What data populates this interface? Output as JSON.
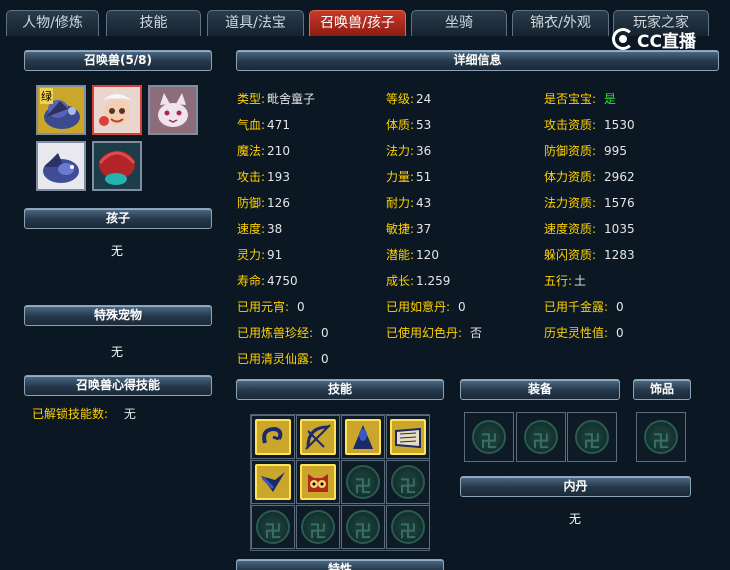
{
  "tabs": [
    {
      "label": "人物/修炼",
      "active": false
    },
    {
      "label": "技能",
      "active": false
    },
    {
      "label": "道具/法宝",
      "active": false
    },
    {
      "label": "召唤兽/孩子",
      "active": true
    },
    {
      "label": "坐骑",
      "active": false
    },
    {
      "label": "锦衣/外观",
      "active": false
    },
    {
      "label": "玩家之家",
      "active": false
    }
  ],
  "watermark": "CC直播",
  "left": {
    "pets_header": "召唤兽(5/8)",
    "pet_badge": "绿",
    "children_header": "孩子",
    "children_value": "无",
    "special_header": "特殊宠物",
    "special_value": "无",
    "insight_header": "召唤兽心得技能",
    "unlocked_label": "已解锁技能数:",
    "unlocked_value": "无"
  },
  "details": {
    "header": "详细信息",
    "col1": [
      {
        "label": "类型:",
        "value": "毗舍童子"
      },
      {
        "label": "气血:",
        "value": "471"
      },
      {
        "label": "魔法:",
        "value": "210"
      },
      {
        "label": "攻击:",
        "value": "193"
      },
      {
        "label": "防御:",
        "value": "126"
      },
      {
        "label": "速度:",
        "value": "38"
      },
      {
        "label": "灵力:",
        "value": "91"
      },
      {
        "label": "寿命:",
        "value": "4750"
      }
    ],
    "col2": [
      {
        "label": "等级:",
        "value": "24"
      },
      {
        "label": "体质:",
        "value": "53"
      },
      {
        "label": "法力:",
        "value": "36"
      },
      {
        "label": "力量:",
        "value": "51"
      },
      {
        "label": "耐力:",
        "value": "43"
      },
      {
        "label": "敏捷:",
        "value": "37"
      },
      {
        "label": "潜能:",
        "value": "120"
      },
      {
        "label": "成长:",
        "value": "1.259"
      }
    ],
    "col3": [
      {
        "label": "是否宝宝:",
        "value": "是"
      },
      {
        "label": "攻击资质:",
        "value": "1530"
      },
      {
        "label": "防御资质:",
        "value": "995"
      },
      {
        "label": "体力资质:",
        "value": "2962"
      },
      {
        "label": "法力资质:",
        "value": "1576"
      },
      {
        "label": "速度资质:",
        "value": "1035"
      },
      {
        "label": "躲闪资质:",
        "value": "1283"
      },
      {
        "label": "五行:",
        "value": "土"
      }
    ],
    "used": [
      {
        "label": "已用元宵:",
        "value": "0"
      },
      {
        "label": "已用如意丹:",
        "value": "0"
      },
      {
        "label": "已用千金露:",
        "value": "0"
      },
      {
        "label": "已用炼兽珍经:",
        "value": "0"
      },
      {
        "label": "已使用幻色丹:",
        "value": "否"
      },
      {
        "label": "历史灵性值:",
        "value": "0"
      },
      {
        "label": "已用清灵仙露:",
        "value": "0"
      }
    ]
  },
  "skills": {
    "header": "技能",
    "icons": [
      "hook-skill-icon",
      "bow-skill-icon",
      "shadow-skill-icon",
      "scroll-skill-icon",
      "shield-skill-icon",
      "owl-skill-icon"
    ]
  },
  "equipment": {
    "header": "装备"
  },
  "ornament": {
    "header": "饰品"
  },
  "inner_dan": {
    "header": "内丹",
    "value": "无"
  },
  "traits": {
    "header": "特性"
  }
}
